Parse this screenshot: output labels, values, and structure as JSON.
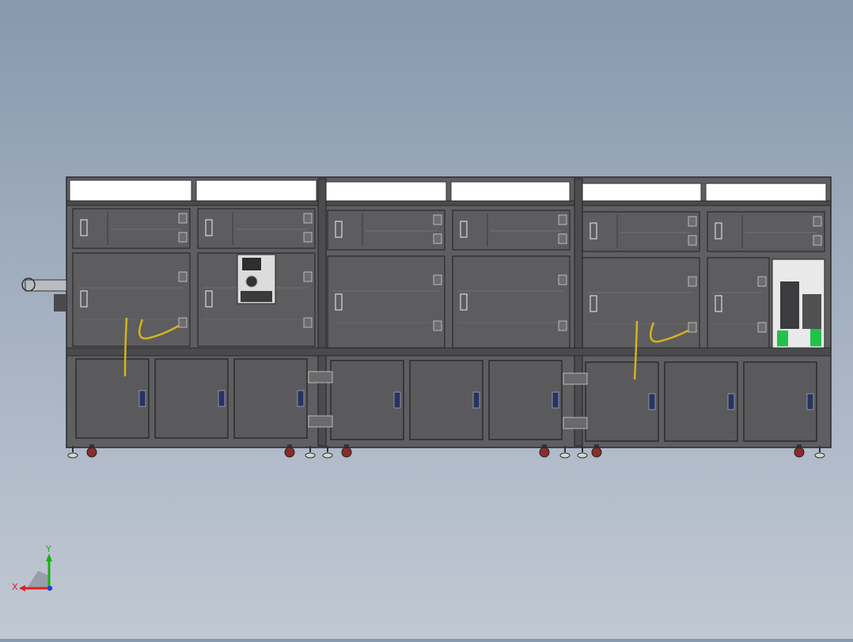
{
  "viewport": {
    "background_top": "#8898ad",
    "background_bottom": "#c1c8d3"
  },
  "machine": {
    "module_count": 3,
    "frame_color": "#5f5f62",
    "panel_color": "#5d5d60",
    "cabinet_door_color": "#5a5a5c",
    "top_cover_color": "#ffffff",
    "cable_color": "#d4b21c",
    "module_highlight_color": "#22c24a"
  },
  "triad": {
    "x_label": "X",
    "y_label": "Y",
    "x_color": "#e02020",
    "y_color": "#18b018",
    "z_color": "#2040d0"
  }
}
